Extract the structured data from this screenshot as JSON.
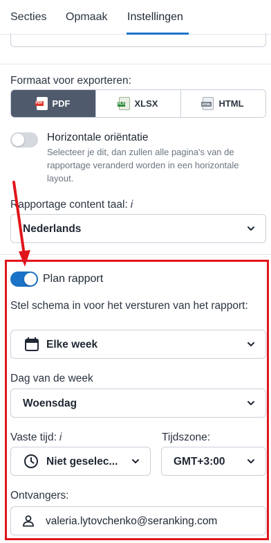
{
  "tabs": [
    {
      "label": "Secties"
    },
    {
      "label": "Opmaak"
    },
    {
      "label": "Instellingen"
    }
  ],
  "export_format": {
    "label": "Formaat voor exporteren:",
    "options": [
      {
        "label": "PDF",
        "selected": true
      },
      {
        "label": "XLSX",
        "selected": false
      },
      {
        "label": "HTML",
        "selected": false
      }
    ]
  },
  "horizontal": {
    "title": "Horizontale oriëntatie",
    "description": "Selecteer je dit, dan zullen alle pagina's van de rapportage veranderd worden in een horizontale layout.",
    "enabled": false
  },
  "language": {
    "label": "Rapportage content taal:",
    "info": "i",
    "value": "Nederlands"
  },
  "plan": {
    "label": "Plan rapport",
    "enabled": true,
    "schedule_label": "Stel schema in voor het versturen van het rapport:",
    "schedule_value": "Elke week",
    "day_label": "Dag van de week",
    "day_value": "Woensdag",
    "time_label": "Vaste tijd:",
    "time_info": "i",
    "time_value": "Niet geselec...",
    "tz_label": "Tijdszone:",
    "tz_value": "GMT+3:00",
    "recipients_label": "Ontvangers:",
    "recipients_value": "valeria.lytovchenko@seranking.com"
  },
  "colors": {
    "accent": "#1a73c7",
    "highlight": "#e0151b",
    "selected_segment": "#4f5a6d"
  }
}
